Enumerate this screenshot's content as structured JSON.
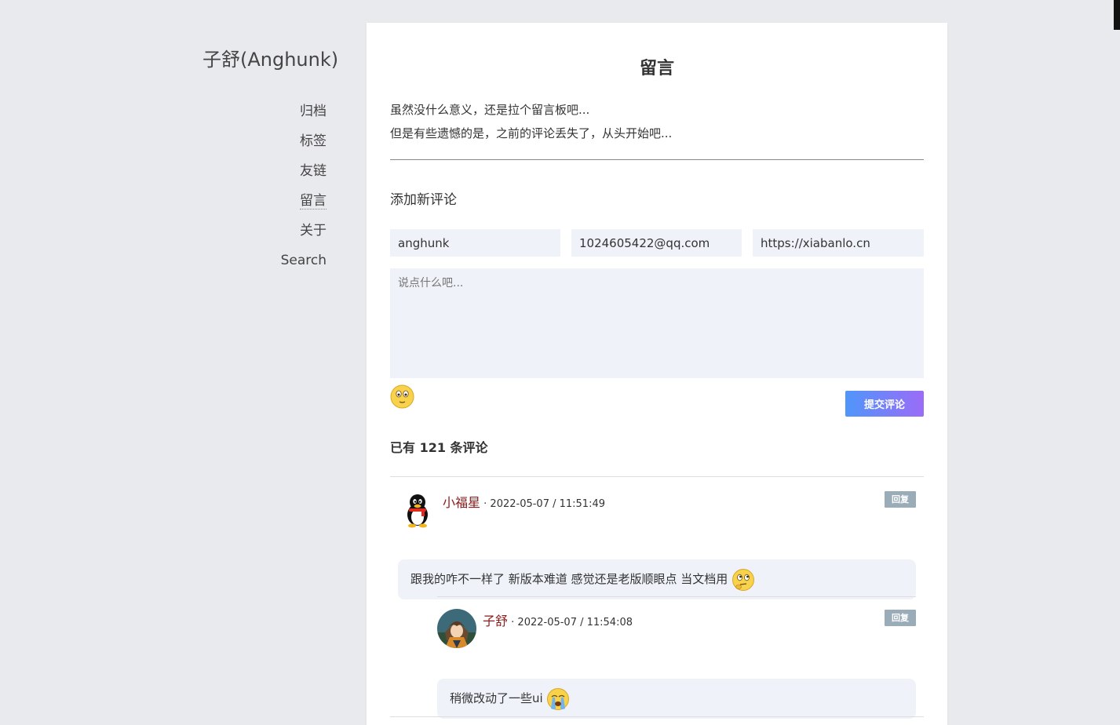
{
  "site": {
    "title": "子舒(Anghunk)",
    "nav": [
      "归档",
      "标签",
      "友链",
      "留言",
      "关于",
      "Search"
    ],
    "active": "留言"
  },
  "post": {
    "title": "留言",
    "intro_line1": "虽然没什么意义，还是拉个留言板吧...",
    "intro_line2": "但是有些遗憾的是，之前的评论丢失了，从头开始吧..."
  },
  "form": {
    "heading": "添加新评论",
    "name_value": "anghunk",
    "email_value": "1024605422@qq.com",
    "url_value": "https://xiabanlo.cn",
    "textarea_placeholder": "说点什么吧...",
    "submit_label": "提交评论"
  },
  "comments_count_label": "已有 121 条评论",
  "comments": [
    {
      "author": "小福星",
      "meta": "· 2022-05-07 / 11:51:49",
      "reply_label": "回复",
      "text": "跟我的咋不一样了 新版本难道 感觉还是老版顺眼点 当文档用",
      "emoji": "thinking-face-icon",
      "avatar": "qq-penguin-icon"
    },
    {
      "author": "子舒",
      "meta": "· 2022-05-07 / 11:54:08",
      "reply_label": "回复",
      "text": "稍微改动了一些ui",
      "emoji": "crying-face-icon",
      "avatar": "anime-character-avatar"
    }
  ],
  "colors": {
    "background": "#e9eaed",
    "card": "#ffffff",
    "input_bg": "#eff2f9",
    "author": "#8b1a1a",
    "reply_btn": "#9aacb8",
    "submit_gradient_start": "#4f96fa",
    "submit_gradient_end": "#9b6cf7"
  }
}
